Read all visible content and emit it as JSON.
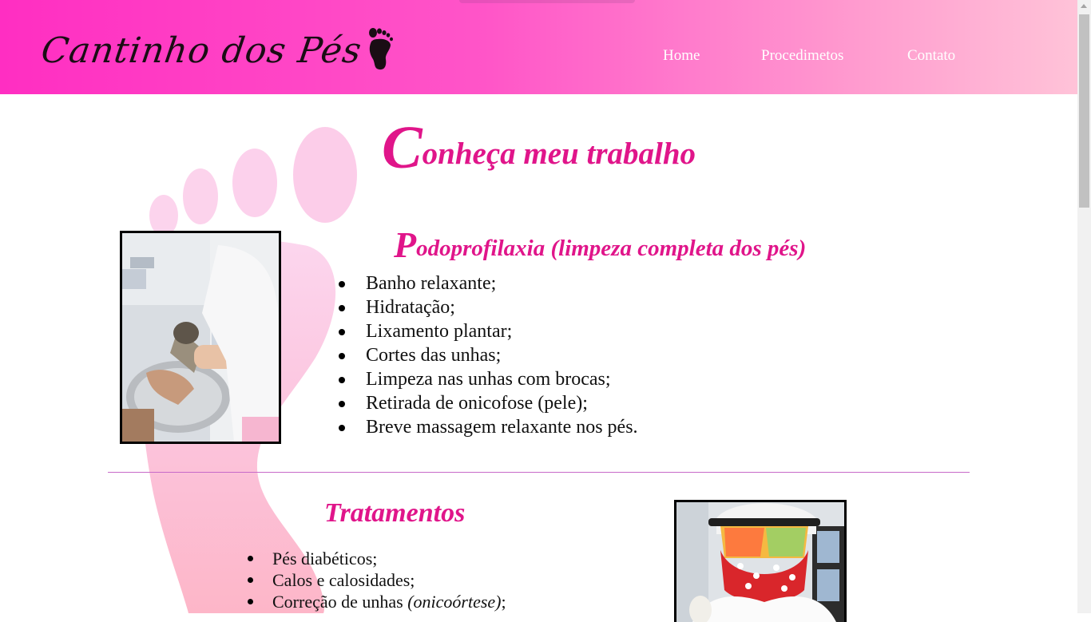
{
  "header": {
    "logo_text": "Cantinho dos Pés",
    "nav": [
      {
        "label": "Home"
      },
      {
        "label": "Procedimetos"
      },
      {
        "label": "Contato"
      }
    ]
  },
  "main": {
    "title_initial": "C",
    "title_rest": "onheça meu trabalho"
  },
  "section1": {
    "title_initial": "P",
    "title_rest": "odoprofilaxia (limpeza completa dos pés)",
    "items": [
      "Banho relaxante;",
      "Hidratação;",
      "Lixamento plantar;",
      "Cortes das unhas;",
      "Limpeza nas unhas com brocas;",
      "Retirada de onicofose (pele);",
      "Breve massagem relaxante nos pés."
    ]
  },
  "section2": {
    "title": "Tratamentos",
    "items": [
      {
        "text": "Pés diabéticos;",
        "italic": ""
      },
      {
        "text": "Calos e calosidades;",
        "italic": ""
      },
      {
        "text": "Correção de unhas ",
        "italic": "(onicoórtese)",
        "suffix": ";"
      }
    ]
  },
  "colors": {
    "accent": "#e0158a",
    "header_start": "#ff2ec2",
    "header_end": "#ffc3d8",
    "divider": "#c86ac9"
  },
  "icons": {
    "logo_icon": "footprint-icon",
    "background": "footprint-background"
  }
}
